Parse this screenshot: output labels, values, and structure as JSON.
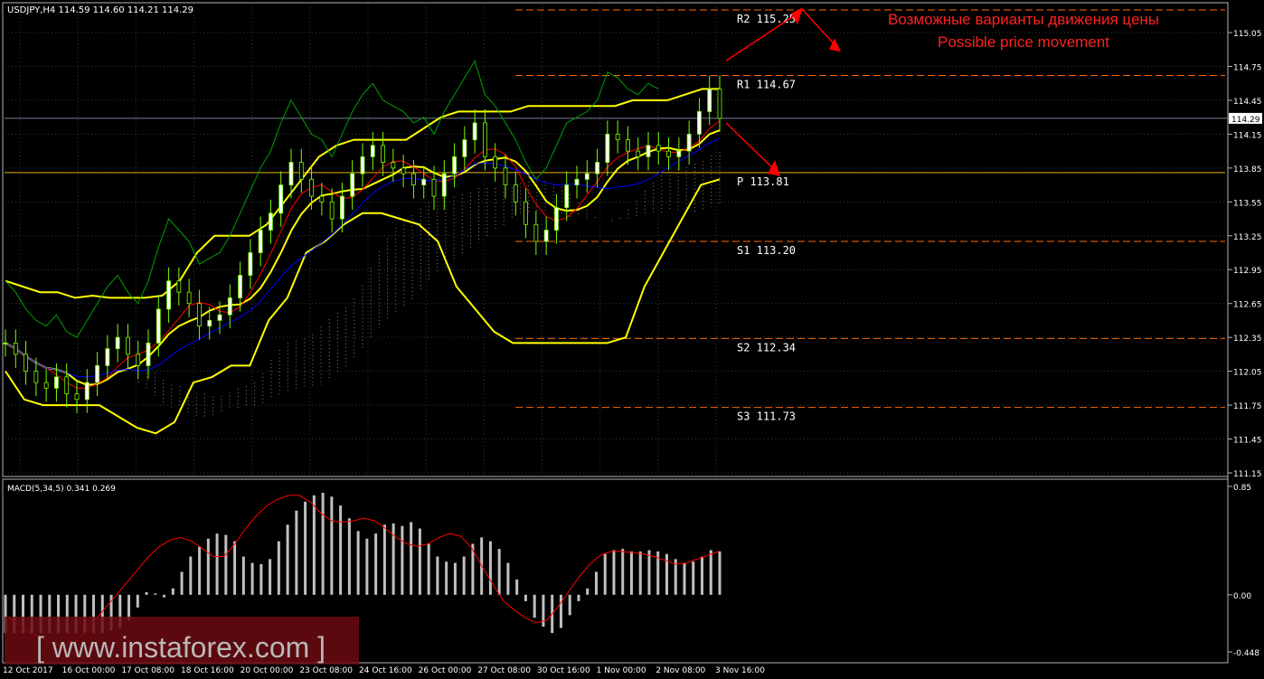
{
  "symbol_header": "USDJPY,H4  114.59 114.60 114.21 114.29",
  "annotation": {
    "ru": "Возможные варианты движения цены",
    "en": "Possible price movement"
  },
  "watermark": "[ www.instaforex.com ]",
  "colors": {
    "background": "#000000",
    "grid": "#2a3a3a",
    "candle": "#7cfc00",
    "candle_body": "#ffffff",
    "envelope": "#ffff00",
    "tenkan": "#ff0000",
    "kijun": "#0000ff",
    "chikou": "#00a000",
    "cloud": "#d2b48c",
    "level": "#ff6a00",
    "pivot": "#e3b100",
    "current_price": "#9aa6c4",
    "arrow": "#ff0000",
    "macd_bars": "#c0c0c0",
    "macd_signal": "#ff0000",
    "annotation": "#ff0000"
  },
  "chart_data": [
    {
      "type": "candlestick",
      "title": "USDJPY,H4",
      "ylim": [
        111.15,
        115.3
      ],
      "y_ticks": [
        "115.05",
        "114.75",
        "114.45",
        "114.15",
        "113.85",
        "113.55",
        "113.25",
        "112.95",
        "112.65",
        "112.35",
        "112.05",
        "111.75",
        "111.45",
        "111.15"
      ],
      "x_ticks": [
        "12 Oct 2017",
        "16 Oct 00:00",
        "17 Oct 08:00",
        "18 Oct 16:00",
        "20 Oct 00:00",
        "23 Oct 08:00",
        "24 Oct 16:00",
        "26 Oct 00:00",
        "27 Oct 08:00",
        "30 Oct 16:00",
        "1 Nov 00:00",
        "2 Nov 08:00",
        "3 Nov 16:00"
      ],
      "current_price": "114.29",
      "levels": [
        {
          "name": "R2",
          "value": 115.25,
          "label": "R2 115.25"
        },
        {
          "name": "R1",
          "value": 114.67,
          "label": "R1 114.67"
        },
        {
          "name": "P",
          "value": 113.81,
          "label": "P 113.81"
        },
        {
          "name": "S1",
          "value": 113.2,
          "label": "S1 113.20"
        },
        {
          "name": "S2",
          "value": 112.34,
          "label": "S2 112.34"
        },
        {
          "name": "S3",
          "value": 111.73,
          "label": "S3 111.73"
        }
      ],
      "close_series": [
        112.3,
        112.2,
        112.05,
        111.95,
        111.9,
        112.0,
        111.85,
        111.8,
        111.95,
        112.1,
        112.25,
        112.35,
        112.2,
        112.1,
        112.3,
        112.6,
        112.85,
        112.75,
        112.65,
        112.45,
        112.5,
        112.55,
        112.7,
        112.9,
        113.1,
        113.3,
        113.45,
        113.7,
        113.9,
        113.75,
        113.6,
        113.55,
        113.4,
        113.6,
        113.8,
        113.95,
        114.05,
        113.9,
        113.85,
        113.8,
        113.7,
        113.75,
        113.6,
        113.8,
        113.95,
        114.1,
        114.25,
        113.95,
        113.85,
        113.7,
        113.55,
        113.35,
        113.2,
        113.3,
        113.5,
        113.7,
        113.75,
        113.8,
        113.9,
        114.15,
        114.1,
        114.0,
        113.95,
        114.05,
        114.0,
        113.95,
        114.0,
        114.15,
        114.35,
        114.55,
        114.29
      ],
      "upper_envelope": [
        112.85,
        112.8,
        112.75,
        112.75,
        112.7,
        112.72,
        112.7,
        112.7,
        112.7,
        112.72,
        112.85,
        113.1,
        113.25,
        113.25,
        113.25,
        113.35,
        113.55,
        113.75,
        113.95,
        114.05,
        114.1,
        114.1,
        114.1,
        114.1,
        114.2,
        114.3,
        114.35,
        114.35,
        114.35,
        114.35,
        114.4,
        114.4,
        114.4,
        114.4,
        114.4,
        114.4,
        114.45,
        114.45,
        114.45,
        114.5,
        114.55,
        114.55
      ],
      "lower_envelope": [
        112.05,
        111.8,
        111.75,
        111.75,
        111.75,
        111.75,
        111.65,
        111.55,
        111.5,
        111.6,
        111.95,
        112.0,
        112.1,
        112.1,
        112.5,
        112.7,
        113.1,
        113.2,
        113.35,
        113.45,
        113.45,
        113.4,
        113.35,
        113.2,
        112.8,
        112.6,
        112.4,
        112.3,
        112.3,
        112.3,
        112.3,
        112.3,
        112.3,
        112.35,
        112.8,
        113.1,
        113.4,
        113.7,
        113.75
      ],
      "macd": {
        "label": "MACD(5,34,5) 0.341 0.269",
        "ylim": [
          -0.448,
          0.85
        ],
        "y_ticks": [
          "0.85",
          "0.00",
          "-0.448"
        ],
        "histogram": [
          -0.3,
          -0.3,
          -0.3,
          -0.3,
          -0.3,
          -0.3,
          -0.3,
          -0.3,
          -0.3,
          -0.3,
          -0.3,
          -0.3,
          -0.28,
          -0.26,
          -0.2,
          -0.1,
          0.02,
          0.01,
          -0.02,
          0.05,
          0.18,
          0.3,
          0.38,
          0.44,
          0.48,
          0.47,
          0.42,
          0.3,
          0.25,
          0.24,
          0.28,
          0.42,
          0.55,
          0.66,
          0.73,
          0.78,
          0.8,
          0.77,
          0.7,
          0.6,
          0.5,
          0.44,
          0.48,
          0.55,
          0.56,
          0.54,
          0.57,
          0.52,
          0.4,
          0.3,
          0.26,
          0.25,
          0.3,
          0.4,
          0.45,
          0.42,
          0.36,
          0.25,
          0.12,
          -0.05,
          -0.18,
          -0.25,
          -0.3,
          -0.26,
          -0.16,
          -0.05,
          0.05,
          0.18,
          0.32,
          0.35,
          0.36,
          0.34,
          0.34,
          0.35,
          0.34,
          0.32,
          0.28,
          0.25,
          0.26,
          0.3,
          0.35,
          0.34
        ],
        "signal": [
          -0.18,
          -0.24,
          -0.3,
          -0.34,
          -0.38,
          -0.4,
          -0.38,
          -0.3,
          -0.2,
          -0.1,
          0.0,
          0.1,
          0.2,
          0.3,
          0.38,
          0.43,
          0.45,
          0.42,
          0.36,
          0.3,
          0.3,
          0.4,
          0.52,
          0.62,
          0.7,
          0.75,
          0.78,
          0.78,
          0.73,
          0.64,
          0.58,
          0.57,
          0.58,
          0.6,
          0.58,
          0.52,
          0.45,
          0.4,
          0.38,
          0.4,
          0.45,
          0.48,
          0.46,
          0.37,
          0.22,
          0.08,
          -0.05,
          -0.12,
          -0.18,
          -0.22,
          -0.2,
          -0.1,
          0.02,
          0.14,
          0.24,
          0.31,
          0.34,
          0.34,
          0.33,
          0.32,
          0.3,
          0.27,
          0.24,
          0.25,
          0.28,
          0.31,
          0.34
        ]
      }
    }
  ]
}
